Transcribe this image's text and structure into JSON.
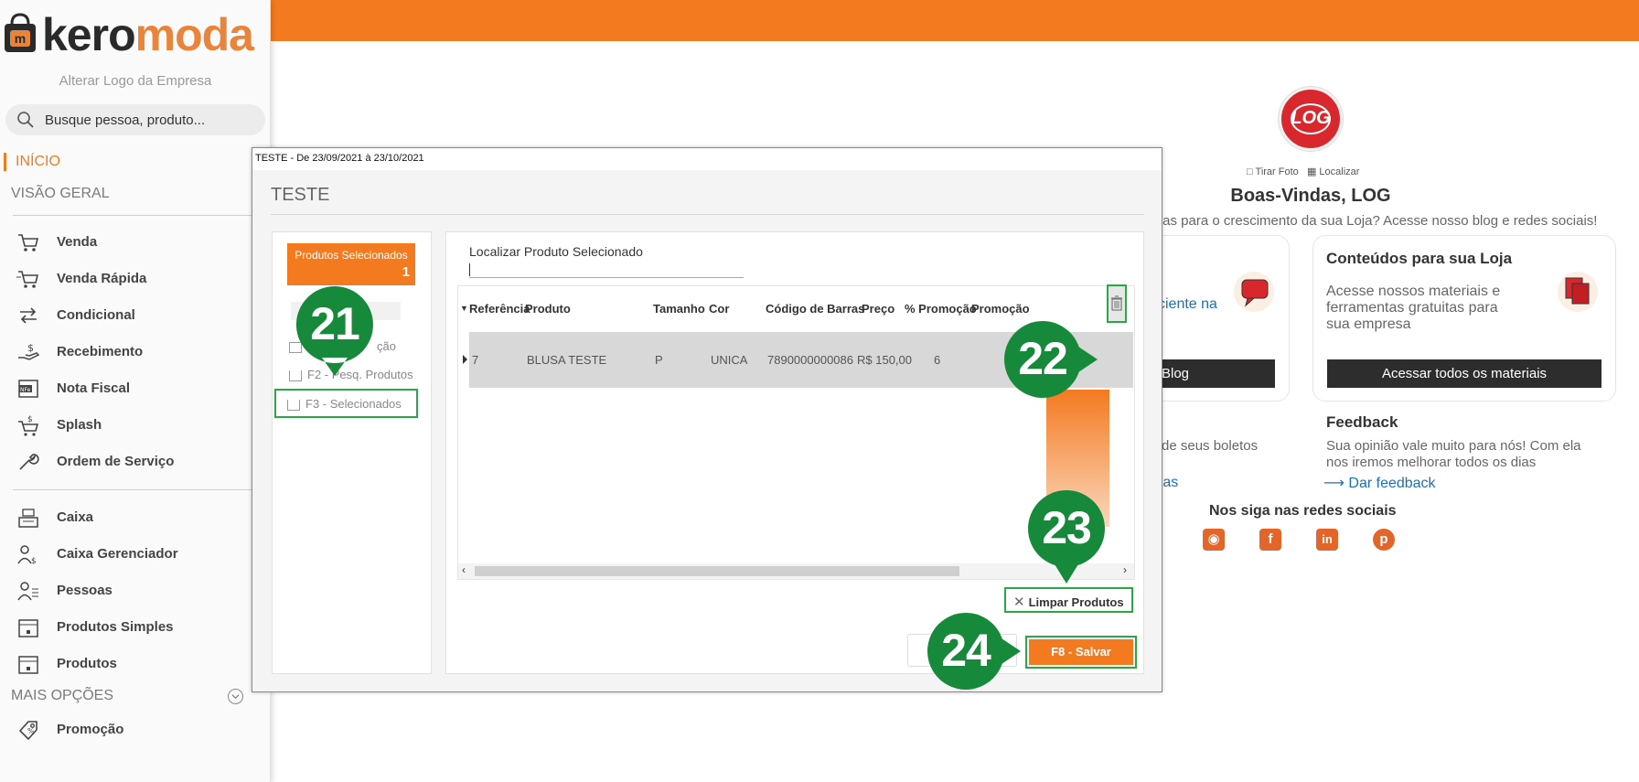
{
  "brand": {
    "logo_left": "kero",
    "logo_right": "moda",
    "alter_logo": "Alterar Logo da Empresa"
  },
  "search": {
    "placeholder": "Busque pessoa, produto..."
  },
  "nav": {
    "inicio": "INÍCIO",
    "visao_geral": "VISÃO GERAL",
    "items": [
      {
        "label": "Venda",
        "icon": "cart-icon"
      },
      {
        "label": "Venda Rápida",
        "icon": "cart-fast-icon"
      },
      {
        "label": "Condicional",
        "icon": "cart-swap-icon"
      },
      {
        "label": "Recebimento",
        "icon": "hand-money-icon"
      },
      {
        "label": "Nota Fiscal",
        "icon": "nfe-icon"
      },
      {
        "label": "Splash",
        "icon": "cart-dollar-icon"
      },
      {
        "label": "Ordem de Serviço",
        "icon": "wrench-icon"
      }
    ],
    "items2": [
      {
        "label": "Caixa",
        "icon": "cash-register-icon"
      },
      {
        "label": "Caixa Gerenciador",
        "icon": "person-cash-icon"
      },
      {
        "label": "Pessoas",
        "icon": "people-icon"
      },
      {
        "label": "Produtos Simples",
        "icon": "box-icon"
      },
      {
        "label": "Produtos",
        "icon": "box-icon"
      }
    ],
    "mais_opcoes": "MAIS OPÇÕES",
    "promocao": "Promoção"
  },
  "welcome": {
    "avatar_text": "LOG",
    "tirar_foto": "Tirar Foto",
    "localizar": "Localizar",
    "title": "Boas-Vindas, LOG",
    "tips": "dicas para o crescimento da sua Loja? Acesse nosso blog e redes sociais!",
    "card1_link": "ciente na",
    "card1_button": "Blog",
    "card2_title": "Conteúdos para sua Loja",
    "card2_text": "Acesse nossos materiais e ferramentas gratuitas para sua empresa",
    "card2_button": "Acessar todos os materiais",
    "boletos": "de seus boletos",
    "ras": "ras",
    "feedback_title": "Feedback",
    "feedback_text": "Sua opinião vale muito para nós! Com ela nos iremos melhorar todos os dias",
    "feedback_link": "Dar feedback",
    "social_title": "Nos siga nas redes sociais"
  },
  "modal": {
    "window_title": "TESTE - De 23/09/2021 à 23/10/2021",
    "heading": "TESTE",
    "selected_label": "Produtos Selecionados",
    "selected_count": "1",
    "opt_promocao": "ção",
    "opt_f2": "F2 - Pesq. Produtos",
    "opt_f3": "F3 - Selecionados",
    "locate_label": "Localizar Produto Selecionado",
    "columns": [
      "Referência",
      "Produto",
      "Tamanho",
      "Cor",
      "Código de Barras",
      "Preço",
      "% Promoção",
      "Promoção"
    ],
    "row": {
      "ref": "7",
      "produto": "BLUSA TESTE",
      "tamanho": "P",
      "cor": "UNICA",
      "codigo": "7890000000086",
      "preco": "R$ 150,00",
      "pct": "6"
    },
    "clear_button": "Limpar Produtos",
    "save_button": "F8 - Salvar"
  },
  "callouts": [
    "21",
    "22",
    "23",
    "24"
  ],
  "colors": {
    "accent": "#f47a20",
    "callout": "#168a3a",
    "highlight": "#2aa846",
    "brand_red": "#d9282d"
  }
}
